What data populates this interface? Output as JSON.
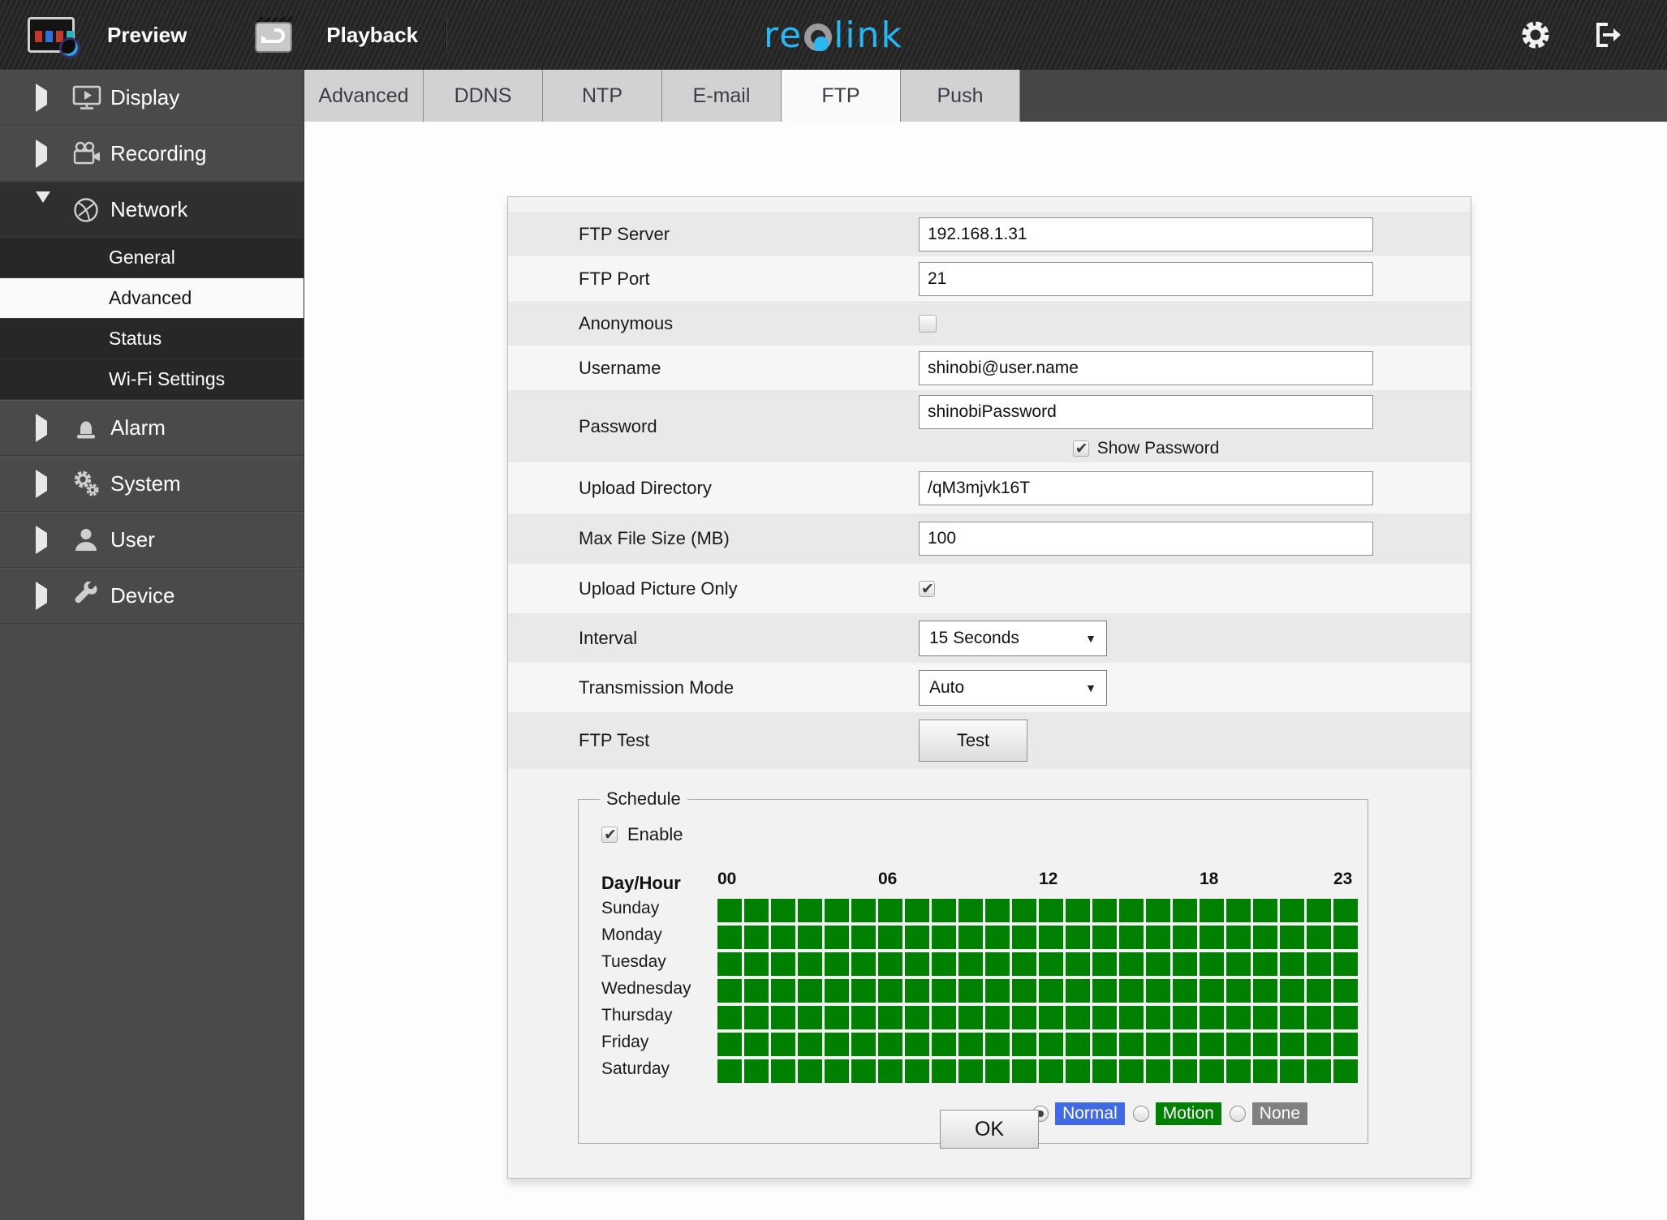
{
  "topbar": {
    "preview_label": "Preview",
    "playback_label": "Playback",
    "logo_re": "re",
    "logo_link": "link"
  },
  "sidebar": {
    "items": [
      {
        "label": "Display",
        "expanded": false
      },
      {
        "label": "Recording",
        "expanded": false
      },
      {
        "label": "Network",
        "expanded": true,
        "children": [
          {
            "label": "General",
            "selected": false
          },
          {
            "label": "Advanced",
            "selected": true
          },
          {
            "label": "Status",
            "selected": false
          },
          {
            "label": "Wi-Fi Settings",
            "selected": false
          }
        ]
      },
      {
        "label": "Alarm",
        "expanded": false
      },
      {
        "label": "System",
        "expanded": false
      },
      {
        "label": "User",
        "expanded": false
      },
      {
        "label": "Device",
        "expanded": false
      }
    ]
  },
  "tabs": [
    {
      "label": "Advanced",
      "active": false
    },
    {
      "label": "DDNS",
      "active": false
    },
    {
      "label": "NTP",
      "active": false
    },
    {
      "label": "E-mail",
      "active": false
    },
    {
      "label": "FTP",
      "active": true
    },
    {
      "label": "Push",
      "active": false
    }
  ],
  "form": {
    "ftp_server": {
      "label": "FTP Server",
      "value": "192.168.1.31"
    },
    "ftp_port": {
      "label": "FTP Port",
      "value": "21"
    },
    "anonymous": {
      "label": "Anonymous",
      "checked": false
    },
    "username": {
      "label": "Username",
      "value": "shinobi@user.name"
    },
    "password": {
      "label": "Password",
      "value": "shinobiPassword",
      "show_password_label": "Show Password",
      "show_password_checked": true
    },
    "upload_directory": {
      "label": "Upload Directory",
      "value": "/qM3mjvk16T"
    },
    "max_file_size": {
      "label": "Max File Size (MB)",
      "value": "100"
    },
    "upload_picture_only": {
      "label": "Upload Picture Only",
      "checked": true
    },
    "interval": {
      "label": "Interval",
      "value": "15 Seconds"
    },
    "transmission_mode": {
      "label": "Transmission Mode",
      "value": "Auto"
    },
    "ftp_test": {
      "label": "FTP Test",
      "button_label": "Test"
    }
  },
  "schedule": {
    "legend": "Schedule",
    "enable": {
      "label": "Enable",
      "checked": true
    },
    "day_hour_label": "Day/Hour",
    "hour_labels": [
      {
        "text": "00",
        "col": 0
      },
      {
        "text": "06",
        "col": 6
      },
      {
        "text": "12",
        "col": 12
      },
      {
        "text": "18",
        "col": 18
      },
      {
        "text": "23",
        "col": 23
      }
    ],
    "days": [
      "Sunday",
      "Monday",
      "Tuesday",
      "Wednesday",
      "Thursday",
      "Friday",
      "Saturday"
    ],
    "hours_per_day": 24,
    "cell_state_all": "motion",
    "cell_color": "#008000",
    "modes": [
      {
        "label": "Normal",
        "color": "#4169e1",
        "selected": true
      },
      {
        "label": "Motion",
        "color": "#008000",
        "selected": false
      },
      {
        "label": "None",
        "color": "#808080",
        "selected": false
      }
    ]
  },
  "ok_button_label": "OK",
  "colors": {
    "logo_cyan": "#29b7f2",
    "logo_gray": "#9b9b9b",
    "schedule_green": "#008000",
    "normal_blue": "#4169e1",
    "none_gray": "#808080",
    "topbar_dark": "#282828",
    "sidebar_gray": "#4a4a4a"
  }
}
